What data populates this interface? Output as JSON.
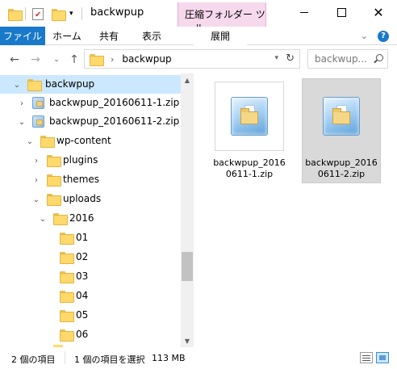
{
  "title": {
    "folder": "backwpup",
    "context_tab_header": "圧縮フォルダー ツール"
  },
  "ribbon": {
    "file": "ファイル",
    "home": "ホーム",
    "share": "共有",
    "view": "表示",
    "extract": "展開"
  },
  "address": {
    "path": "backwpup",
    "search_placeholder": "backwup..."
  },
  "tree": [
    {
      "label": "backwpup",
      "type": "folder",
      "selected": true
    },
    {
      "label": "backwpup_20160611-1.zip",
      "type": "zip"
    },
    {
      "label": "backwpup_20160611-2.zip",
      "type": "zip"
    },
    {
      "label": "wp-content",
      "type": "folder"
    },
    {
      "label": "plugins",
      "type": "folder"
    },
    {
      "label": "themes",
      "type": "folder"
    },
    {
      "label": "uploads",
      "type": "folder"
    },
    {
      "label": "2016",
      "type": "folder"
    },
    {
      "label": "01",
      "type": "folder"
    },
    {
      "label": "02",
      "type": "folder"
    },
    {
      "label": "03",
      "type": "folder"
    },
    {
      "label": "04",
      "type": "folder"
    },
    {
      "label": "05",
      "type": "folder"
    },
    {
      "label": "06",
      "type": "folder"
    }
  ],
  "files": [
    {
      "name": "backwpup_20160611-1.zip",
      "selected": false
    },
    {
      "name": "backwpup_20160611-2.zip",
      "selected": true
    }
  ],
  "status": {
    "item_count": "2 個の項目",
    "selection": "1 個の項目を選択",
    "size": "113 MB"
  },
  "colors": {
    "accent": "#1979ca",
    "selection": "#cce8ff",
    "context_tab": "#f6d9ec"
  }
}
